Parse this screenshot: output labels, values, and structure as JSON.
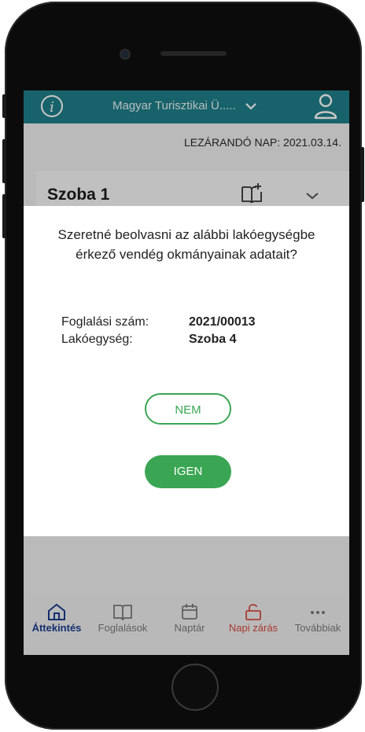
{
  "app_bar": {
    "org_name": "Magyar Turisztikai Ü.....",
    "info_icon": "info-icon",
    "user_icon": "user-icon"
  },
  "closing_day": "LEZÁRANDÓ NAP: 2021.03.14.",
  "room_card": {
    "title": "Szoba 1"
  },
  "dialog": {
    "question": "Szeretné beolvasni az alábbi lakóegységbe érkező vendég okmányainak adatait?",
    "rows": [
      {
        "label": "Foglalási szám:",
        "value": "2021/00013"
      },
      {
        "label": "Lakóegység:",
        "value": "Szoba 4"
      }
    ],
    "no_label": "NEM",
    "yes_label": "IGEN"
  },
  "bottom_nav": {
    "items": [
      {
        "label": "Áttekintés",
        "icon": "home-icon"
      },
      {
        "label": "Foglalások",
        "icon": "book-icon"
      },
      {
        "label": "Naptár",
        "icon": "calendar-icon"
      },
      {
        "label": "Napi zárás",
        "icon": "unlock-icon"
      },
      {
        "label": "Továbbiak",
        "icon": "more-icon"
      }
    ]
  },
  "colors": {
    "primary_teal": "#1f7f8a",
    "accent_green": "#3aa653",
    "active_nav": "#1a3c8c",
    "warning_red": "#d8493e"
  }
}
